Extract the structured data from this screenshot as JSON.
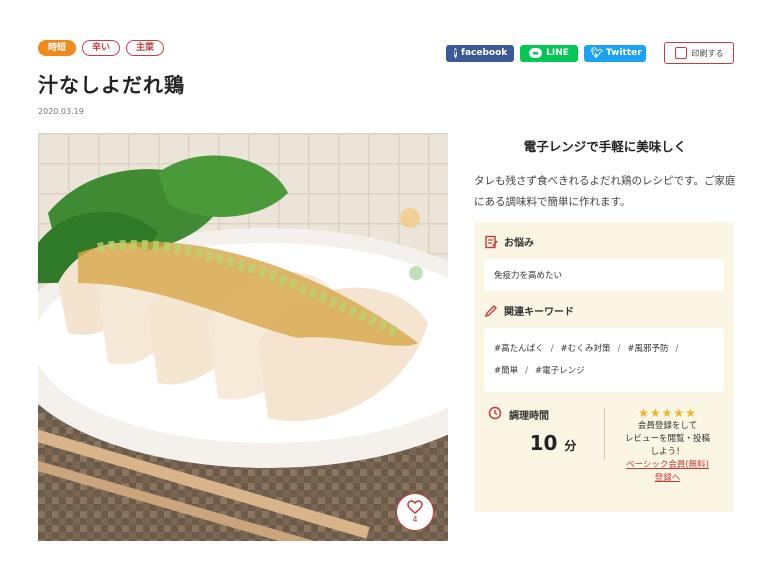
{
  "tags": [
    "時短",
    "辛い",
    "主菜"
  ],
  "share": {
    "facebook": "facebook",
    "line": "LINE",
    "twitter": "Twitter",
    "print": "印刷する"
  },
  "recipe": {
    "title": "汁なしよだれ鶏",
    "date": "2020.03.19",
    "like_count": "4",
    "subtitle": "電子レンジで手軽に美味しく",
    "description": "タレも残さず食べきれるよだれ鶏のレシピです。ご家庭にある調味料で簡単に作れます。"
  },
  "worry": {
    "heading": "お悩み",
    "value": "免疫力を高めたい"
  },
  "keywords": {
    "heading": "関連キーワード",
    "items": [
      "#高たんぱく",
      "#むくみ対策",
      "#風邪予防",
      "#簡単",
      "#電子レンジ"
    ]
  },
  "cook_time": {
    "label": "調理時間",
    "value": "10",
    "unit": "分"
  },
  "member": {
    "stars": "★★★★★",
    "line1": "会員登録をして",
    "line2": "レビューを閲覧・投稿",
    "line3": "しよう！",
    "link1": "ベーシック会員(無料)",
    "link2": "登録へ"
  },
  "colors": {
    "accent_red": "#c83a3a",
    "tag_orange": "#f08a1a",
    "panel_bg": "#fbf6e4",
    "star": "#f5b324"
  }
}
